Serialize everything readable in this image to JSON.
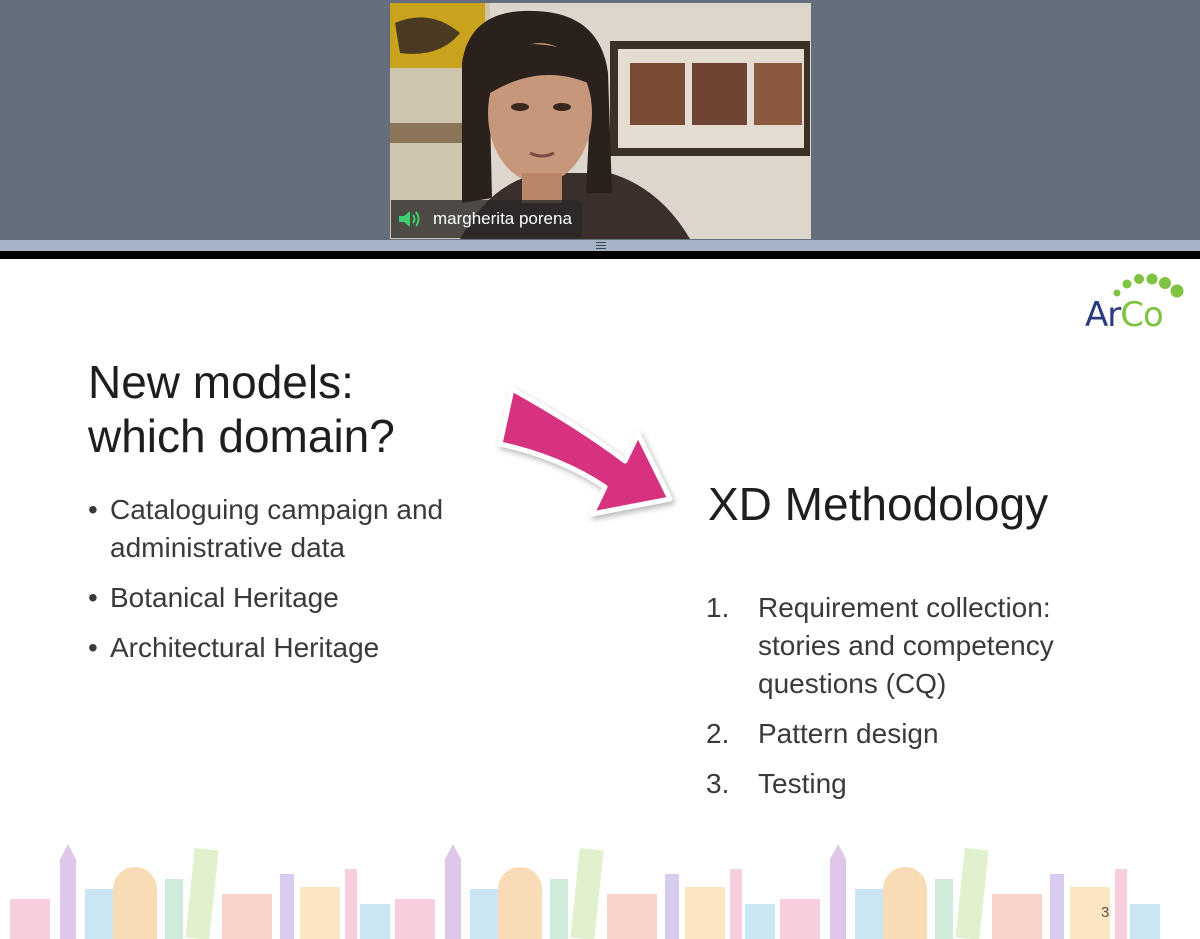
{
  "video": {
    "participant_name": "margherita porena",
    "speaker_icon": "speaker-active-icon"
  },
  "slide": {
    "left_title_line1": "New models:",
    "left_title_line2": "which domain?",
    "bullets": [
      "Cataloguing campaign and administrative data",
      "Botanical Heritage",
      "Architectural Heritage"
    ],
    "right_title": "XD Methodology",
    "steps": [
      {
        "num": "1.",
        "text": "Requirement collection: stories and competency questions (CQ)"
      },
      {
        "num": "2.",
        "text": "Pattern design"
      },
      {
        "num": "3.",
        "text": "Testing"
      }
    ],
    "bullet_glyph": "•",
    "logo_text_part1": "Ar",
    "logo_text_part2": "Co",
    "slide_number": "3"
  },
  "colors": {
    "strip_bg": "#646e7c",
    "arrow": "#d6307f",
    "logo_blue": "#2b3a7e",
    "logo_green": "#7fc342"
  }
}
